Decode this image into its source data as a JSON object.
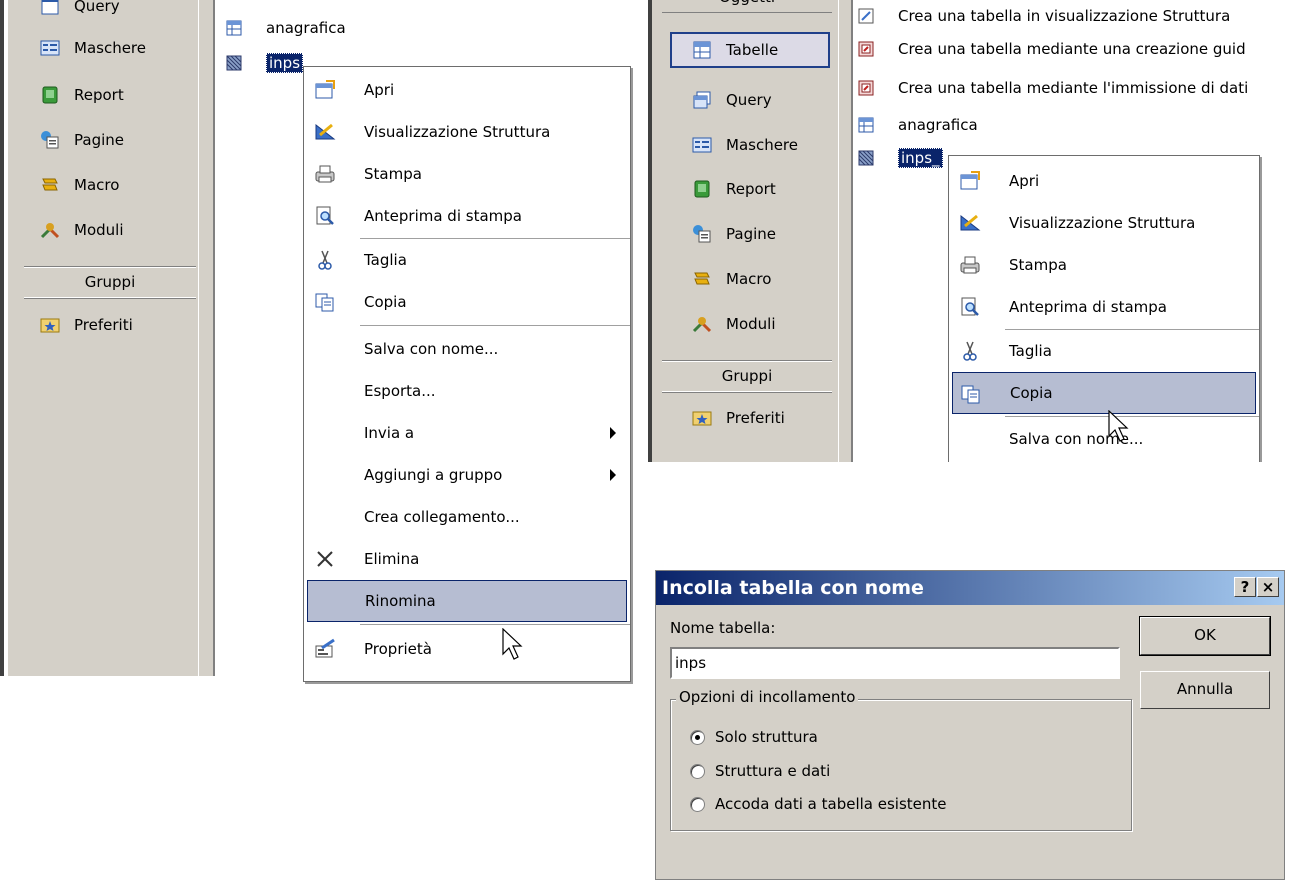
{
  "left_panel": {
    "objects": [
      {
        "label": "Query",
        "icon": "query-icon"
      },
      {
        "label": "Maschere",
        "icon": "form-icon"
      },
      {
        "label": "Report",
        "icon": "report-icon"
      },
      {
        "label": "Pagine",
        "icon": "page-icon"
      },
      {
        "label": "Macro",
        "icon": "macro-icon"
      },
      {
        "label": "Moduli",
        "icon": "module-icon"
      }
    ],
    "groups_header": "Gruppi",
    "favorites": "Preferiti",
    "list": [
      {
        "label": "anagrafica",
        "icon": "table-icon"
      },
      {
        "label": "inps",
        "icon": "linked-table-icon"
      }
    ]
  },
  "context_menu_left": {
    "items": [
      {
        "label": "Apri",
        "icon": "open-table-icon"
      },
      {
        "label": "Visualizzazione Struttura",
        "icon": "design-view-icon"
      },
      {
        "label": "Stampa",
        "icon": "printer-icon"
      },
      {
        "label": "Anteprima di stampa",
        "icon": "print-preview-icon"
      },
      {
        "label": "Taglia",
        "icon": "scissors-icon"
      },
      {
        "label": "Copia",
        "icon": "copy-icon"
      },
      {
        "label": "Salva con nome...",
        "icon": ""
      },
      {
        "label": "Esporta...",
        "icon": ""
      },
      {
        "label": "Invia a",
        "icon": ""
      },
      {
        "label": "Aggiungi a gruppo",
        "icon": ""
      },
      {
        "label": "Crea collegamento...",
        "icon": ""
      },
      {
        "label": "Elimina",
        "icon": "delete-x-icon"
      },
      {
        "label": "Rinomina",
        "icon": ""
      },
      {
        "label": "Proprietà",
        "icon": "properties-icon"
      }
    ],
    "highlighted": "Rinomina"
  },
  "right_panel": {
    "header_partial": "Oggetti",
    "objects": [
      {
        "label": "Tabelle",
        "icon": "table-icon"
      },
      {
        "label": "Query",
        "icon": "query-icon"
      },
      {
        "label": "Maschere",
        "icon": "form-icon"
      },
      {
        "label": "Report",
        "icon": "report-icon"
      },
      {
        "label": "Pagine",
        "icon": "page-icon"
      },
      {
        "label": "Macro",
        "icon": "macro-icon"
      },
      {
        "label": "Moduli",
        "icon": "module-icon"
      }
    ],
    "groups_header": "Gruppi",
    "favorites": "Preferiti",
    "list": [
      {
        "label": "Crea una tabella in visualizzazione Struttura",
        "icon": "wizard-icon"
      },
      {
        "label": "Crea una tabella mediante una creazione guid",
        "icon": "wizard-icon"
      },
      {
        "label": "Crea una tabella mediante l'immissione di dati",
        "icon": "wizard-icon"
      },
      {
        "label": "anagrafica",
        "icon": "table-icon"
      },
      {
        "label": "inps_",
        "icon": "linked-table-icon"
      }
    ]
  },
  "context_menu_right": {
    "items": [
      {
        "label": "Apri"
      },
      {
        "label": "Visualizzazione Struttura"
      },
      {
        "label": "Stampa"
      },
      {
        "label": "Anteprima di stampa"
      },
      {
        "label": "Taglia"
      },
      {
        "label": "Copia"
      },
      {
        "label": "Salva con nome..."
      }
    ],
    "highlighted": "Copia"
  },
  "dialog": {
    "title": "Incolla tabella con nome",
    "help_button": "?",
    "close_button": "×",
    "name_label": "Nome tabella:",
    "name_value": "inps",
    "ok_button": "OK",
    "cancel_button": "Annulla",
    "options_legend": "Opzioni di incollamento",
    "options": [
      "Solo struttura",
      "Struttura e dati",
      "Accoda dati a tabella esistente"
    ],
    "selected_option": "Solo struttura"
  },
  "colors": {
    "selection_bg": "#0a246a",
    "menu_hot": "#b6bdd2",
    "window_face": "#d4d0c8"
  }
}
